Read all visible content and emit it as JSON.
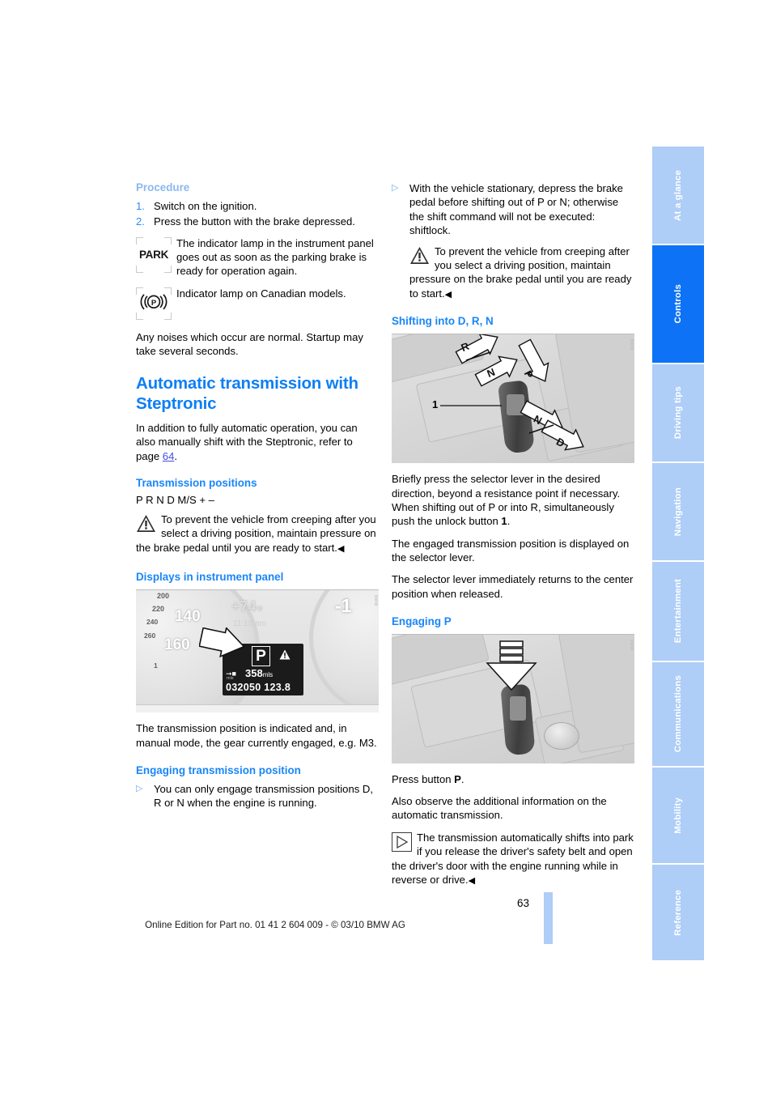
{
  "page": {
    "number": "63",
    "footer_note": "Online Edition for Part no. 01 41 2 604 009 - © 03/10 BMW AG"
  },
  "colors": {
    "heading_blue": "#0d7ff5",
    "subheading_blue": "#1a86f7",
    "light_blue": "#8ab8f0",
    "tab_inactive": "#aecdf7",
    "tab_active": "#0d72f5",
    "link": "#3f4fe0"
  },
  "left_column": {
    "procedure": {
      "heading": "Procedure",
      "steps": [
        {
          "num": "1.",
          "text": "Switch on the ignition."
        },
        {
          "num": "2.",
          "text": "Press the button with the brake depressed."
        }
      ],
      "icon_notes": [
        {
          "icon": "park-indicator-icon",
          "glyph": "PARK",
          "text": "The indicator lamp in the instrument panel goes out as soon as the parking brake is ready for operation again."
        },
        {
          "icon": "parking-brake-canada-icon",
          "glyph": "(P)",
          "text": "Indicator lamp on Canadian models."
        }
      ],
      "closing_text": "Any noises which occur are normal. Startup may take several seconds."
    },
    "automatic_transmission": {
      "heading": "Automatic transmission with Steptronic",
      "intro_before_link": "In addition to fully automatic operation, you can also manually shift with the Steptronic, refer to page ",
      "intro_link": "64",
      "intro_after_link": "."
    },
    "transmission_positions": {
      "heading": "Transmission positions",
      "positions": "P R N D M/S + –",
      "warning": "To prevent the vehicle from creeping after you select a driving position, maintain pressure on the brake pedal until you are ready to start.",
      "end_mark": "◀"
    },
    "displays_panel": {
      "heading": "Displays in instrument panel",
      "figure_name": "instrument-cluster-figure",
      "cluster": {
        "speed_ticks": [
          "200",
          "220",
          "240",
          "260",
          "1"
        ],
        "speed_big": [
          "140",
          "160"
        ],
        "gear_right": "-1",
        "temperature": "+74",
        "temperature_unit": "°F",
        "clock": "11:15 am",
        "transmission_position": "P",
        "range": "358",
        "range_unit": "mls",
        "odometer": "032050",
        "trip": "123.8",
        "unit_label": "mls"
      },
      "caption": "The transmission position is indicated and, in manual mode, the gear currently engaged, e.g. M3."
    },
    "engaging_position": {
      "heading": "Engaging transmission position",
      "bullet": "You can only engage transmission positions D, R or N when the engine is running."
    }
  },
  "right_column": {
    "shiftlock_bullet": "With the vehicle stationary, depress the brake pedal before shifting out of P or N; otherwise the shift command will not be executed: shiftlock.",
    "shiftlock_warning": "To prevent the vehicle from creeping after you select a driving position, maintain pressure on the brake pedal until you are ready to start.",
    "end_mark": "◀",
    "shifting_section": {
      "heading": "Shifting into D, R, N",
      "figure_name": "selector-lever-directions-figure",
      "figure_labels": [
        "R",
        "N",
        "P",
        "N",
        "D"
      ],
      "figure_callout": "1",
      "paragraph_1_a": "Briefly press the selector lever in the desired direction, beyond a resistance point if necessary. When shifting out of P or into R, simultaneously push the unlock button ",
      "paragraph_1_b": "1",
      "paragraph_1_c": ".",
      "paragraph_2": "The engaged transmission position is displayed on the selector lever.",
      "paragraph_3": "The selector lever immediately returns to the center position when released."
    },
    "engaging_p": {
      "heading": "Engaging P",
      "figure_name": "engaging-park-figure",
      "press_a": "Press button ",
      "press_b": "P",
      "press_c": ".",
      "observe": "Also observe the additional information on the automatic transmission.",
      "note": "The transmission automatically shifts into park if you release the driver's safety belt and open the driver's door with the engine running while in reverse or drive."
    }
  },
  "tabs": [
    {
      "label": "At a glance",
      "active": false
    },
    {
      "label": "Controls",
      "active": true
    },
    {
      "label": "Driving tips",
      "active": false
    },
    {
      "label": "Navigation",
      "active": false
    },
    {
      "label": "Entertainment",
      "active": false
    },
    {
      "label": "Communications",
      "active": false
    },
    {
      "label": "Mobility",
      "active": false
    },
    {
      "label": "Reference",
      "active": false
    }
  ]
}
